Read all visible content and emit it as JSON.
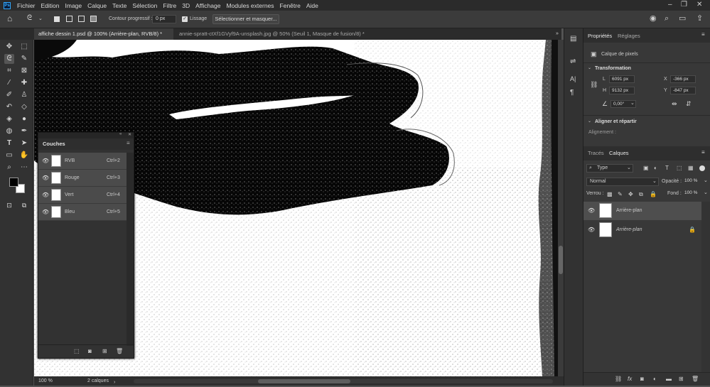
{
  "menu": {
    "logo": "Ps",
    "items": [
      "Fichier",
      "Edition",
      "Image",
      "Calque",
      "Texte",
      "Sélection",
      "Filtre",
      "3D",
      "Affichage",
      "Modules externes",
      "Fenêtre",
      "Aide"
    ]
  },
  "options": {
    "feather_label": "Contour progressif :",
    "feather_value": "0 px",
    "antialias_label": "Lissage",
    "select_mask_button": "Sélectionner et masquer..."
  },
  "tabs": [
    {
      "label": "affiche dessin 1.psd @ 100% (Arrière-plan, RVB/8) *",
      "active": true
    },
    {
      "label": "annie-spratt-ctXf1GVyf9A-unsplash.jpg @ 50% (Seuil 1, Masque de fusion/8) *",
      "active": false
    }
  ],
  "status": {
    "zoom": "100 %",
    "info": "2 calques"
  },
  "channels_panel": {
    "title": "Couches",
    "rows": [
      {
        "name": "RVB",
        "shortcut": "Ctrl+2"
      },
      {
        "name": "Rouge",
        "shortcut": "Ctrl+3"
      },
      {
        "name": "Vert",
        "shortcut": "Ctrl+4"
      },
      {
        "name": "Bleu",
        "shortcut": "Ctrl+5"
      }
    ]
  },
  "properties": {
    "tab_properties": "Propriétés",
    "tab_adjustments": "Réglages",
    "layer_type": "Calque de pixels",
    "transform_title": "Transformation",
    "w_label": "L",
    "w_value": "6091 px",
    "h_label": "H",
    "h_value": "9132 px",
    "x_label": "X",
    "x_value": "-366 px",
    "y_label": "Y",
    "y_value": "-847 px",
    "angle_value": "0,00°",
    "align_title": "Aligner et répartir",
    "align_label": "Alignement :"
  },
  "layers": {
    "tab_paths": "Tracés",
    "tab_layers": "Calques",
    "filter_kind": "Type",
    "blend_mode": "Normal",
    "opacity_label": "Opacité :",
    "opacity_value": "100 %",
    "lock_label": "Verrou :",
    "fill_label": "Fond :",
    "fill_value": "100 %",
    "items": [
      {
        "name": "Arrière-plan",
        "selected": true
      },
      {
        "name": "Arrière-plan",
        "selected": false
      }
    ]
  },
  "colors": {
    "accent": "#31a8ff",
    "foreground": "#000000",
    "background": "#ffffff"
  }
}
